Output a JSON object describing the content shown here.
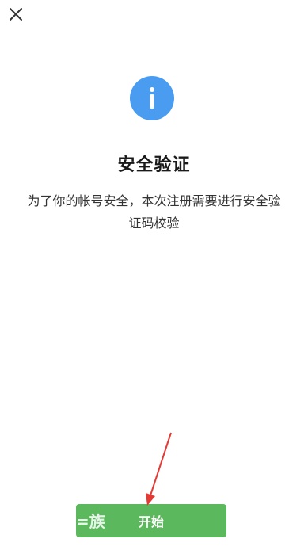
{
  "header": {
    "close_icon": "close-icon"
  },
  "info": {
    "icon": "info-icon",
    "color": "#4a9cf0"
  },
  "content": {
    "title": "安全验证",
    "description": "为了你的帐号安全，本次注册需要进行安全验证码校验"
  },
  "footer": {
    "start_label": "开始",
    "button_color": "#5cb85c",
    "watermark_text": "=族"
  },
  "annotation": {
    "arrow_color": "#e53935"
  }
}
